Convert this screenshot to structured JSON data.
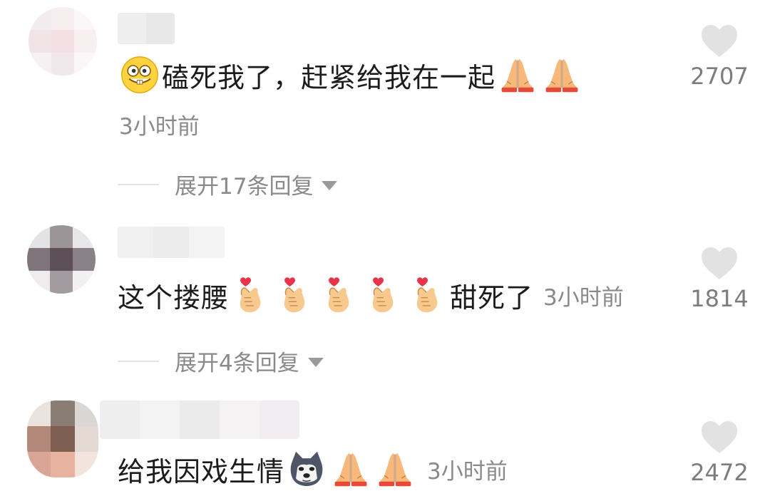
{
  "comments": [
    {
      "text": "磕死我了，赶紧给我在一起",
      "time": "3小时前",
      "likes": "2707",
      "replies": "展开17条回复",
      "icons": [
        "grinning-emoji-icon",
        "pray-hands-icon",
        "pray-hands-icon"
      ]
    },
    {
      "text": "这个搂腰",
      "text_after": "甜死了",
      "time": "3小时前",
      "likes": "1814",
      "replies": "展开4条回复",
      "icons": [
        "finger-heart-icon",
        "finger-heart-icon",
        "finger-heart-icon",
        "finger-heart-icon",
        "finger-heart-icon"
      ]
    },
    {
      "text": "给我因戏生情",
      "time": "3小时前",
      "likes": "2472",
      "icons": [
        "doge-emoji-icon",
        "pray-hands-icon",
        "pray-hands-icon"
      ]
    }
  ],
  "colors": {
    "text": "#1c1c1c",
    "meta": "#8a8a8a",
    "heart": "#e0e0e0"
  }
}
